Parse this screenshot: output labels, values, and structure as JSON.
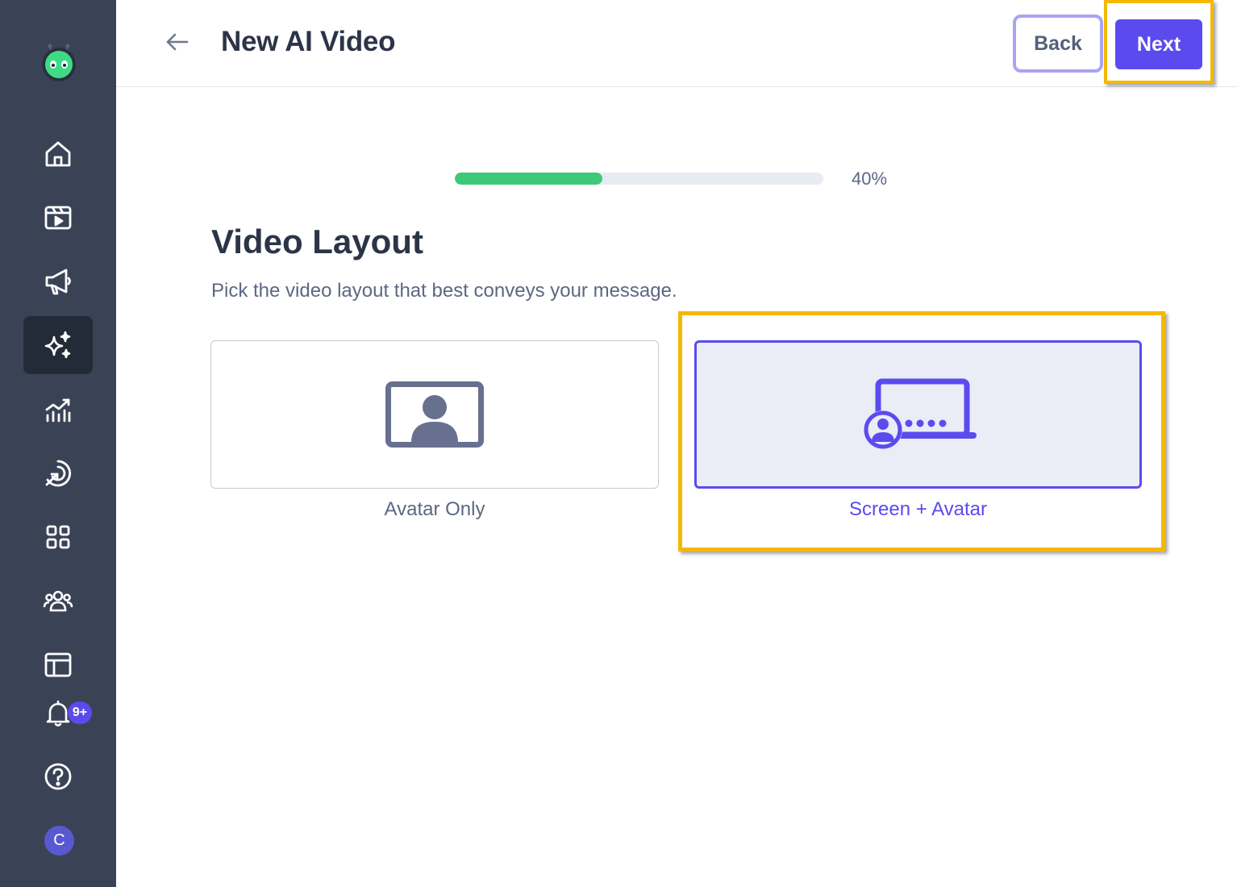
{
  "header": {
    "title": "New AI Video",
    "back_label": "Back",
    "next_label": "Next"
  },
  "progress": {
    "value_percent": 40,
    "label": "40%"
  },
  "section": {
    "title": "Video Layout",
    "subtitle": "Pick the video layout that best conveys your message."
  },
  "options": [
    {
      "label": "Avatar Only",
      "icon": "avatar-frame-icon",
      "selected": false
    },
    {
      "label": "Screen + Avatar",
      "icon": "screen-avatar-icon",
      "selected": true
    }
  ],
  "sidebar": {
    "items": [
      {
        "icon": "home-icon"
      },
      {
        "icon": "video-clapper-icon"
      },
      {
        "icon": "megaphone-icon"
      },
      {
        "icon": "sparkles-icon",
        "active": true
      },
      {
        "icon": "analytics-icon"
      },
      {
        "icon": "target-icon"
      },
      {
        "icon": "apps-grid-icon"
      },
      {
        "icon": "team-icon"
      },
      {
        "icon": "layout-icon"
      },
      {
        "icon": "bell-icon"
      },
      {
        "icon": "help-icon"
      }
    ],
    "notification_badge": "9+",
    "user_initial": "C"
  },
  "colors": {
    "sidebar_bg": "#3a4356",
    "accent": "#5b4bef",
    "progress": "#3dc97a",
    "highlight": "#f5b800"
  }
}
